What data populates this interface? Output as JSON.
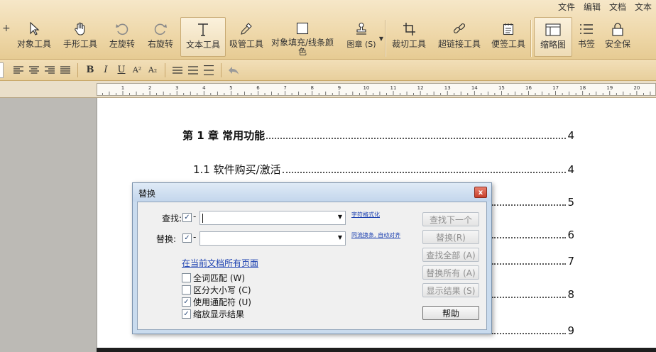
{
  "menubar": [
    "文件",
    "编辑",
    "文档",
    "文本"
  ],
  "ribbon": {
    "plus": "+",
    "tools": [
      {
        "label": "对象工具",
        "icon": "cursor-arrow-icon"
      },
      {
        "label": "手形工具",
        "icon": "hand-icon"
      },
      {
        "label": "左旋转",
        "icon": "rotate-left-icon"
      },
      {
        "label": "右旋转",
        "icon": "rotate-right-icon"
      },
      {
        "label": "文本工具",
        "icon": "text-tool-icon",
        "active": true
      },
      {
        "label": "吸管工具",
        "icon": "eyedropper-icon"
      },
      {
        "label": "对象填充/线条颜色",
        "icon": "fill-color-icon"
      },
      {
        "label": "图章 (S)",
        "icon": "stamp-icon"
      },
      {
        "label": "裁切工具",
        "icon": "crop-icon"
      },
      {
        "label": "超链接工具",
        "icon": "link-icon"
      },
      {
        "label": "便签工具",
        "icon": "note-icon"
      },
      {
        "label": "缩略图",
        "icon": "thumbnail-icon",
        "active": true
      },
      {
        "label": "书签",
        "icon": "bookmark-list-icon"
      },
      {
        "label": "安全保",
        "icon": "security-icon"
      }
    ]
  },
  "formatbar": {
    "bold": "B",
    "italic": "I",
    "underline": "U",
    "superscript": "A²",
    "subscript": "A₂"
  },
  "ruler": {
    "labels": [
      "1",
      "2",
      "3",
      "4",
      "5",
      "6",
      "7",
      "8",
      "9",
      "10",
      "11",
      "12",
      "13",
      "14",
      "15",
      "16",
      "17",
      "18",
      "19",
      "20"
    ]
  },
  "document": {
    "toc": [
      {
        "text": "第 1 章  常用功能",
        "page": "4",
        "bold": true
      },
      {
        "text": "1.1 软件购买/激活",
        "page": "4"
      },
      {
        "text": "",
        "page": "5"
      },
      {
        "text": "",
        "page": "6"
      },
      {
        "text": "",
        "page": "7"
      },
      {
        "text": "",
        "page": "8"
      },
      {
        "text": "",
        "page": "9"
      }
    ]
  },
  "dialog": {
    "title": "替换",
    "close": "x",
    "find_label": "查找:",
    "replace_label": "替换:",
    "find_value": "",
    "replace_value": "",
    "find_link": "字符格式化",
    "replace_link": "同流换条, 自动对齐",
    "scope_link": "在当前文档所有页面",
    "options": [
      {
        "label": "全词匹配 (W)",
        "checked": false
      },
      {
        "label": "区分大小写 (C)",
        "checked": false
      },
      {
        "label": "使用通配符 (U)",
        "checked": true
      },
      {
        "label": "缩放显示结果",
        "checked": true
      }
    ],
    "buttons": [
      {
        "label": "查找下一个",
        "enabled": false
      },
      {
        "label": "替换(R)",
        "enabled": false
      },
      {
        "label": "查找全部 (A)",
        "enabled": false
      },
      {
        "label": "替换所有 (A)",
        "enabled": false
      },
      {
        "label": "显示结果 (S)",
        "enabled": false
      },
      {
        "label": "帮助",
        "enabled": true
      }
    ]
  }
}
